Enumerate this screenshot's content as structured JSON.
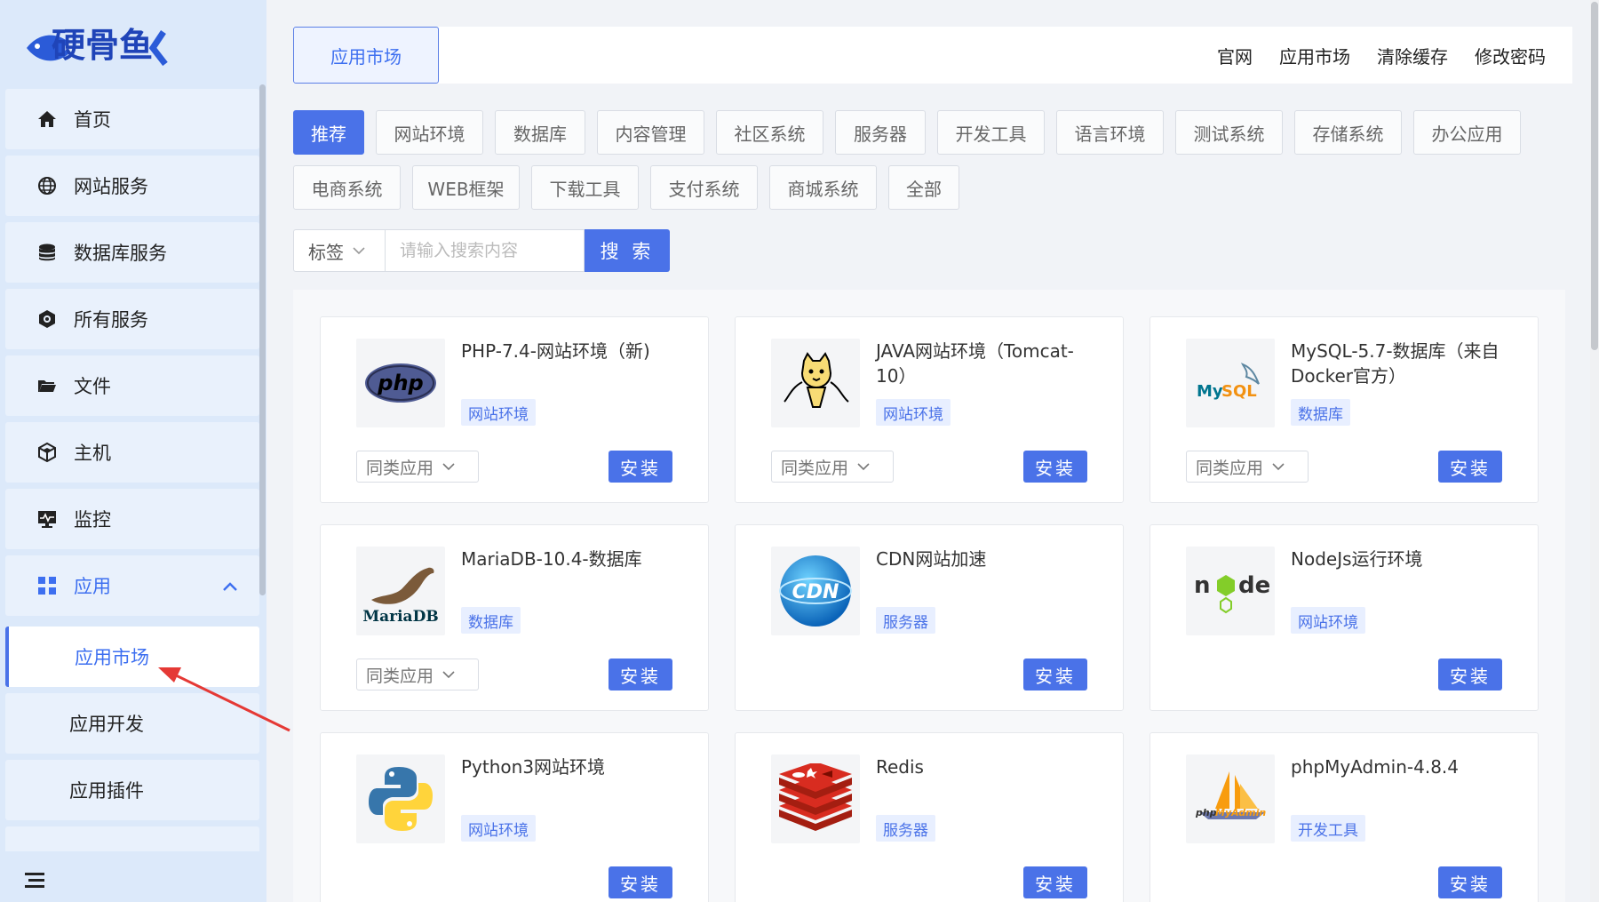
{
  "sidebar": {
    "logo_text": "硬骨鱼",
    "items": [
      {
        "label": "首页",
        "icon": "home-icon"
      },
      {
        "label": "网站服务",
        "icon": "globe-icon"
      },
      {
        "label": "数据库服务",
        "icon": "database-icon"
      },
      {
        "label": "所有服务",
        "icon": "services-icon"
      },
      {
        "label": "文件",
        "icon": "folder-icon"
      },
      {
        "label": "主机",
        "icon": "cube-icon"
      },
      {
        "label": "监控",
        "icon": "monitor-icon"
      },
      {
        "label": "应用",
        "icon": "grid-icon"
      }
    ],
    "sub_items": [
      {
        "label": "应用市场"
      },
      {
        "label": "应用开发"
      },
      {
        "label": "应用插件"
      }
    ]
  },
  "header": {
    "active_tab": "应用市场",
    "links": [
      "官网",
      "应用市场",
      "清除缓存",
      "修改密码"
    ]
  },
  "categories": [
    "推荐",
    "网站环境",
    "数据库",
    "内容管理",
    "社区系统",
    "服务器",
    "开发工具",
    "语言环境",
    "测试系统",
    "存储系统",
    "办公应用",
    "电商系统",
    "WEB框架",
    "下载工具",
    "支付系统",
    "商城系统",
    "全部"
  ],
  "search": {
    "tag_label": "标签",
    "placeholder": "请输入搜索内容",
    "button_label": "搜 索"
  },
  "apps": [
    {
      "name": "PHP-7.4-网站环境（新)",
      "badge": "网站环境",
      "similar": "同类应用",
      "install": "安装",
      "icon": "php-logo"
    },
    {
      "name": "JAVA网站环境（Tomcat-10）",
      "badge": "网站环境",
      "similar": "同类应用",
      "install": "安装",
      "icon": "tomcat-logo"
    },
    {
      "name": "MySQL-5.7-数据库（来自Docker官方）",
      "badge": "数据库",
      "similar": "同类应用",
      "install": "安装",
      "icon": "mysql-logo"
    },
    {
      "name": "MariaDB-10.4-数据库",
      "badge": "数据库",
      "similar": "同类应用",
      "install": "安装",
      "icon": "mariadb-logo",
      "logo_text": "MariaDB"
    },
    {
      "name": "CDN网站加速",
      "badge": "服务器",
      "install": "安装",
      "icon": "cdn-logo",
      "logo_text": "CDN"
    },
    {
      "name": "NodeJs运行环境",
      "badge": "网站环境",
      "install": "安装",
      "icon": "nodejs-logo"
    },
    {
      "name": "Python3网站环境",
      "badge": "网站环境",
      "install": "安装",
      "icon": "python-logo"
    },
    {
      "name": "Redis",
      "badge": "服务器",
      "install": "安装",
      "icon": "redis-logo"
    },
    {
      "name": "phpMyAdmin-4.8.4",
      "badge": "开发工具",
      "install": "安装",
      "icon": "phpmyadmin-logo"
    }
  ],
  "colors": {
    "accent": "#4a72e8",
    "sidebar_bg": "#dce9fa"
  }
}
